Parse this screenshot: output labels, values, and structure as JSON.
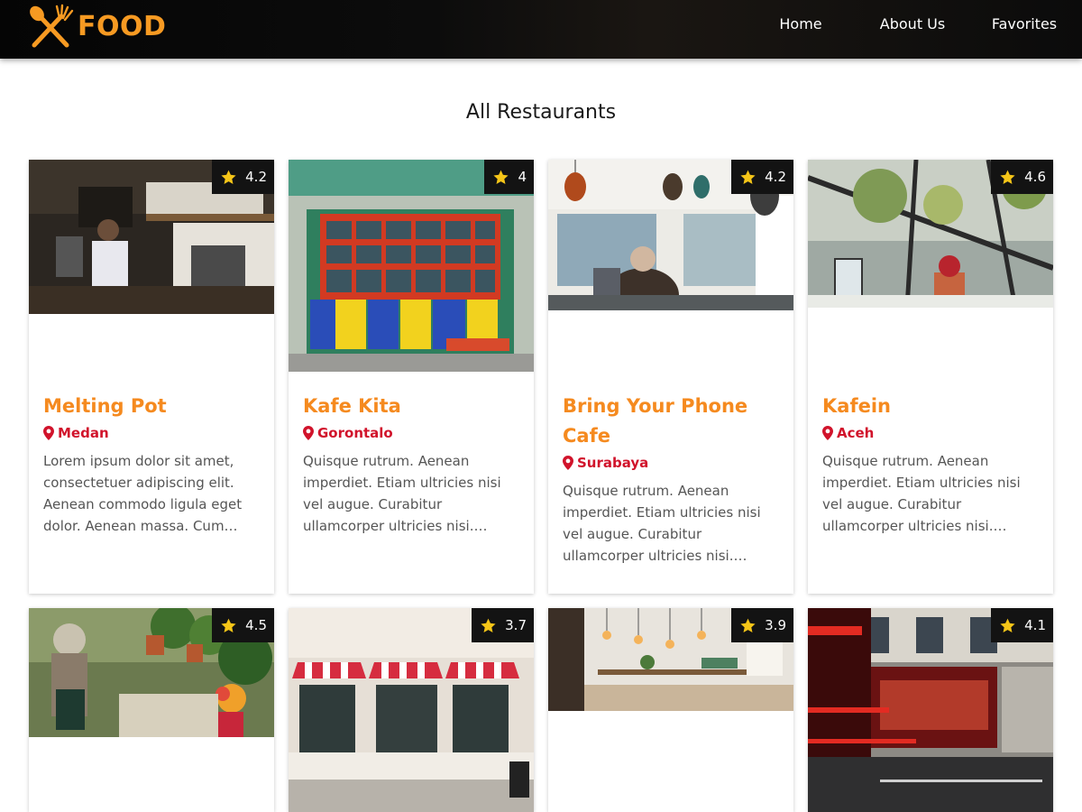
{
  "brand": {
    "name": "FOOD",
    "logo_icon": "fork-spoon-icon",
    "color": "#f79a22"
  },
  "nav": {
    "items": [
      "Home",
      "About Us",
      "Favorites"
    ]
  },
  "page": {
    "title": "All Restaurants"
  },
  "icons": {
    "rating": "star-icon",
    "location": "map-pin-icon"
  },
  "colors": {
    "name": "#f58a1f",
    "city": "#d1132b",
    "star": "#f5c518",
    "badge_bg": "#131313"
  },
  "restaurants": [
    {
      "name": "Melting Pot",
      "city": "Medan",
      "rating": "4.2",
      "description": "Lorem ipsum dolor sit amet, consectetuer adipiscing elit. Aenean commodo ligula eget dolor. Aenean massa. Cum…"
    },
    {
      "name": "Kafe Kita",
      "city": "Gorontalo",
      "rating": "4",
      "description": "Quisque rutrum. Aenean imperdiet. Etiam ultricies nisi vel augue. Curabitur ullamcorper ultricies nisi.…"
    },
    {
      "name": "Bring Your Phone Cafe",
      "city": "Surabaya",
      "rating": "4.2",
      "description": "Quisque rutrum. Aenean imperdiet. Etiam ultricies nisi vel augue. Curabitur ullamcorper ultricies nisi.…"
    },
    {
      "name": "Kafein",
      "city": "Aceh",
      "rating": "4.6",
      "description": "Quisque rutrum. Aenean imperdiet. Etiam ultricies nisi vel augue. Curabitur ullamcorper ultricies nisi.…"
    },
    {
      "rating": "4.5"
    },
    {
      "rating": "3.7"
    },
    {
      "rating": "3.9"
    },
    {
      "rating": "4.1"
    }
  ]
}
